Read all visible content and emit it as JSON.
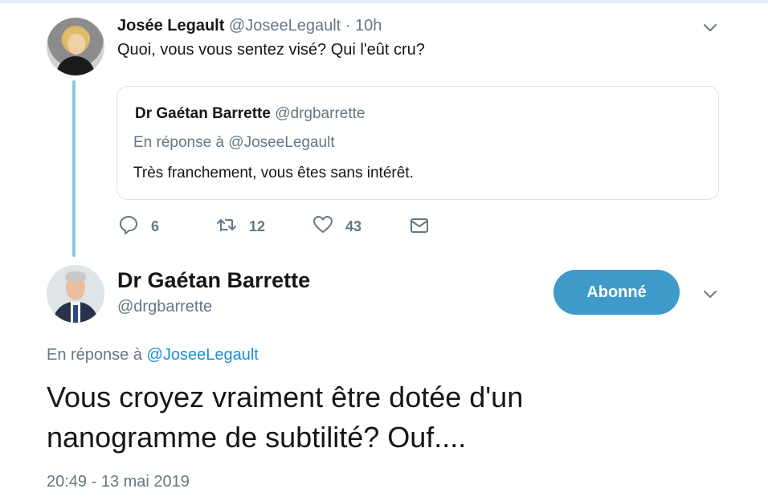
{
  "parent_tweet": {
    "author_name": "Josée Legault",
    "author_handle": "@JoseeLegault",
    "time_sep": " · ",
    "time": "10h",
    "text": "Quoi, vous vous sentez visé? Qui l'eût cru?",
    "quoted": {
      "author_name": "Dr Gaétan Barrette",
      "author_handle": "@drgbarrette",
      "reply_to": "En réponse à @JoseeLegault",
      "text": "Très franchement, vous êtes sans intérêt."
    },
    "actions": {
      "replies": "6",
      "retweets": "12",
      "likes": "43"
    }
  },
  "main_tweet": {
    "author_name": "Dr Gaétan Barrette",
    "author_handle": "@drgbarrette",
    "follow_label": "Abonné",
    "reply_prefix": "En réponse à ",
    "reply_mention": "@JoseeLegault",
    "text": "Vous croyez vraiment être dotée d'un nanogramme de subtilité? Ouf....",
    "timestamp": "20:49 - 13 mai 2019"
  },
  "icons": {
    "reply": "reply-icon",
    "retweet": "retweet-icon",
    "like": "heart-icon",
    "message": "envelope-icon",
    "more": "chevron-down-icon"
  },
  "colors": {
    "accent": "#3d9ac9",
    "link": "#1d8fd6",
    "secondary_text": "#657786",
    "thread_line": "#89c8e6",
    "border": "#dbe3e8"
  }
}
